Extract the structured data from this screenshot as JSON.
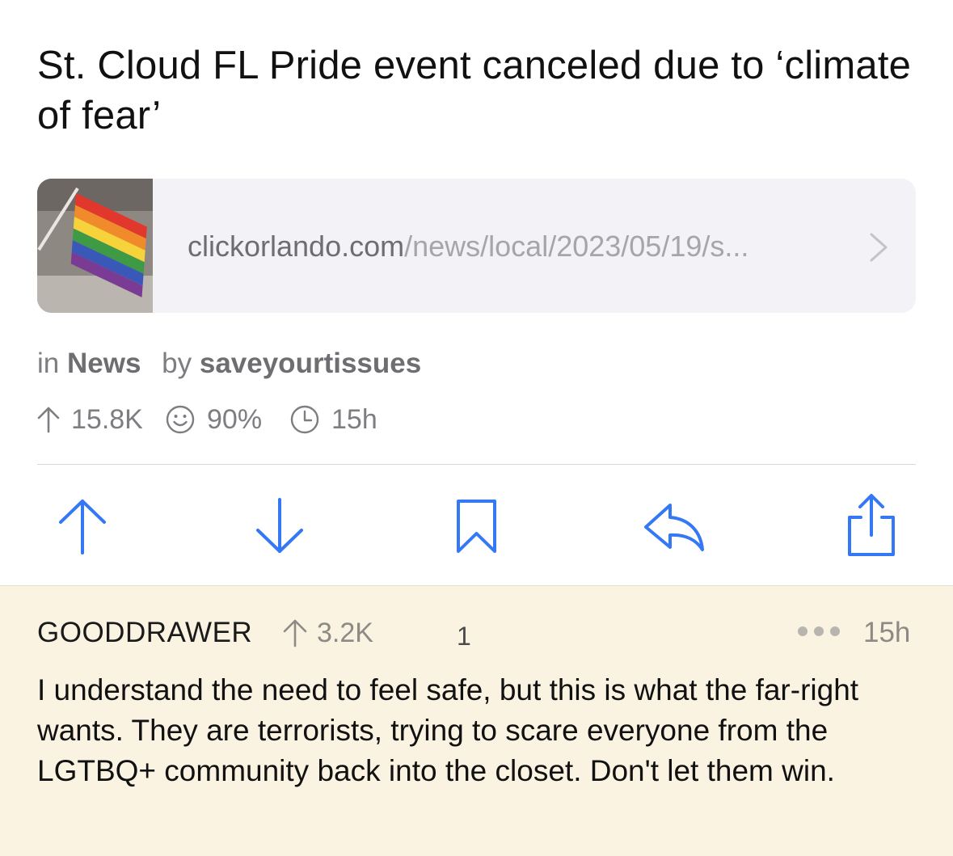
{
  "post": {
    "title": "St. Cloud FL Pride event canceled due to ‘climate of fear’",
    "link": {
      "domain": "clickorlando.com",
      "path": "/news/local/2023/05/19/s..."
    },
    "meta": {
      "in_prefix": "in",
      "community": "News",
      "by_prefix": "by",
      "author": "saveyourtissues"
    },
    "stats": {
      "score": "15.8K",
      "upvote_ratio": "90%",
      "age": "15h"
    },
    "actions": {
      "accent_color": "#3478f6"
    }
  },
  "comment": {
    "author": "GOODDRAWER",
    "score": "3.2K",
    "reply_count": "1",
    "age": "15h",
    "body": "I understand the need to feel safe, but this is what the far-right wants. They are terrorists, trying to scare everyone from the LGTBQ+ community back into the closet. Don't let them win.",
    "background_color": "#fbf3e2"
  }
}
